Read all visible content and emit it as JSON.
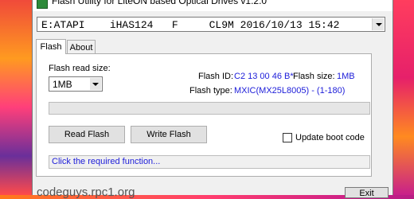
{
  "window": {
    "title": "Flash Utility for LiteON based Optical Drives v1.2.0",
    "drive_select": "E:ATAPI    iHAS124   F     CL9M 2016/10/13 15:42"
  },
  "tabs": [
    {
      "label": "Flash",
      "active": true
    },
    {
      "label": "About",
      "active": false
    }
  ],
  "flash": {
    "read_size_label": "Flash read size:",
    "read_size_value": "1MB",
    "flash_id_label": "Flash ID:",
    "flash_id_value": "C2 13 00 46 B*",
    "flash_size_label": "Flash size:",
    "flash_size_value": "1MB",
    "flash_type_label": "Flash type:",
    "flash_type_value": "MXIC(MX25L8005) - (1-180)",
    "progress_fraction": 0,
    "read_button": "Read Flash",
    "write_button": "Write Flash",
    "update_boot_label": "Update boot code",
    "update_boot_checked": false,
    "status": "Click the required function..."
  },
  "footer": {
    "website": "codeguys.rpc1.org",
    "exit_button": "Exit"
  },
  "colors": {
    "value_blue": "#1c1cd9",
    "progress_green": "#06b025"
  }
}
